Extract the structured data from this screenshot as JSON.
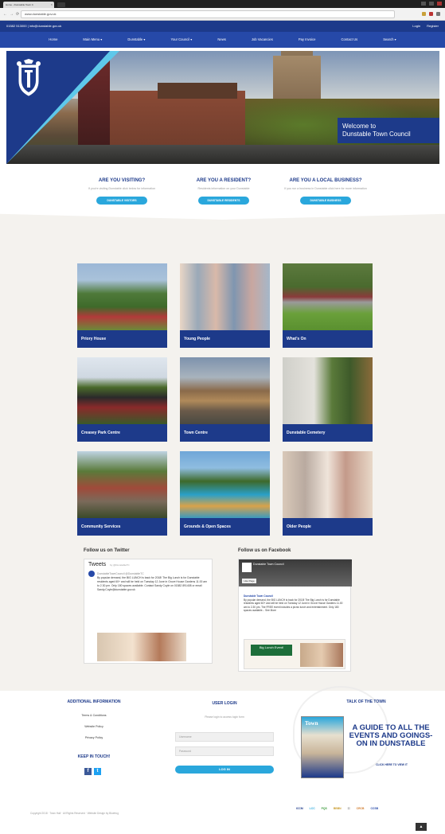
{
  "browser": {
    "tab_title": "Home - Dunstable Town C",
    "url": "www.dunstable.gov.uk",
    "nav_glyphs": [
      "←",
      "→",
      "⟳"
    ]
  },
  "topbar": {
    "contact": "01582 513000 | info@dunstable.gov.uk",
    "login": "Login",
    "register": "Register"
  },
  "nav": {
    "items": [
      "Home",
      "Main Menu ▾",
      "Dunstable ▾",
      "Your Council ▾",
      "News",
      "Job Vacancies",
      "Pay Invoice",
      "Contact Us",
      "Search ▾"
    ]
  },
  "hero": {
    "welcome_line1": "Welcome to",
    "welcome_line2": "Dunstable Town Council"
  },
  "visitors": [
    {
      "title": "ARE YOU VISITING?",
      "text": "If you're visiting Dunstable click below for information",
      "button": "DUNSTABLE VISITORS"
    },
    {
      "title": "ARE YOU A RESIDENT?",
      "text": "Residents information on your Dunstable",
      "button": "DUNSTABLE RESIDENTS"
    },
    {
      "title": "ARE YOU A LOCAL BUSINESS?",
      "text": "If you run a business in Dunstable click here for more information",
      "button": "DUNSTABLE BUSINESS"
    }
  ],
  "tiles": [
    {
      "label": "Priory House"
    },
    {
      "label": "Young People"
    },
    {
      "label": "What's On"
    },
    {
      "label": "Creasey Park Centre"
    },
    {
      "label": "Town Centre"
    },
    {
      "label": "Dunstable Cemetery"
    },
    {
      "label": "Community Services"
    },
    {
      "label": "Grounds & Open Spaces"
    },
    {
      "label": "Older People"
    }
  ],
  "social": {
    "twitter_heading": "Follow us on Twitter",
    "facebook_heading": "Follow us on Facebook",
    "tweets_title": "Tweets",
    "tweets_by": "by @DunstableTC",
    "tweet_author": "DunstableTownCouncil @DunstableTC",
    "tweet_text": "By popular demand, the BIG LUNCH is back for 2018! The Big Lunch is for Dunstable residents aged 60+ and will be held on Tuesday 12 June in Grove House Gardens 11.00 am to 2.30 pm. Only 180 spaces available. Contact Sandy Coyle on 01582 891408 or email Sandy.Coyle@dunstable.gov.uk",
    "fb_page_name": "Dunstable Town Council",
    "fb_like": "Like Page",
    "fb_post_author": "Dunstable Town Council",
    "fb_post": "By popular demand, the BIG LUNCH is back for 2018! The Big Lunch is for Dunstable residents aged 60+ and will be held on Tuesday 12 June in Grove House Gardens 11.00 am to 2.30 pm. The FREE event includes a picnic lunch and entertainment. Only 180 spaces available... See More",
    "fb_card_title": "Big Lunch Event!"
  },
  "footer": {
    "additional_heading": "ADDITIONAL INFORMATION",
    "links": [
      "Terms & Conditions",
      "Website Policy",
      "Privacy Policy"
    ],
    "keep_in_touch": "KEEP IN TOUCH!",
    "social_icons": [
      "f",
      "t"
    ],
    "login_heading": "USER LOGIN",
    "login_sub": "Please login to access login form",
    "username_placeholder": "Username",
    "password_placeholder": "Password",
    "login_button": "LOG IN",
    "talk_heading": "TALK OF THE TOWN",
    "mag_title": "Town",
    "guide_text": "A GUIDE TO ALL THE EVENTS AND GOINGS-ON IN DUNSTABLE",
    "guide_cta": "CLICK HERE TO VIEW IT",
    "copyright": "Copyright 2018 · Town Hall · All Rights Reserved · Website Design by Bluefrog",
    "partners": [
      "ICCM",
      "LCC",
      "PQS",
      "BBBN",
      "☷",
      "CRCB",
      "CCSB"
    ],
    "scroll_top": "▲"
  },
  "colors": {
    "brand_dark": "#1d3a8a",
    "brand_nav": "#2649a8",
    "accent_cyan": "#2aa7dc",
    "section_bg": "#f4f2ee"
  }
}
